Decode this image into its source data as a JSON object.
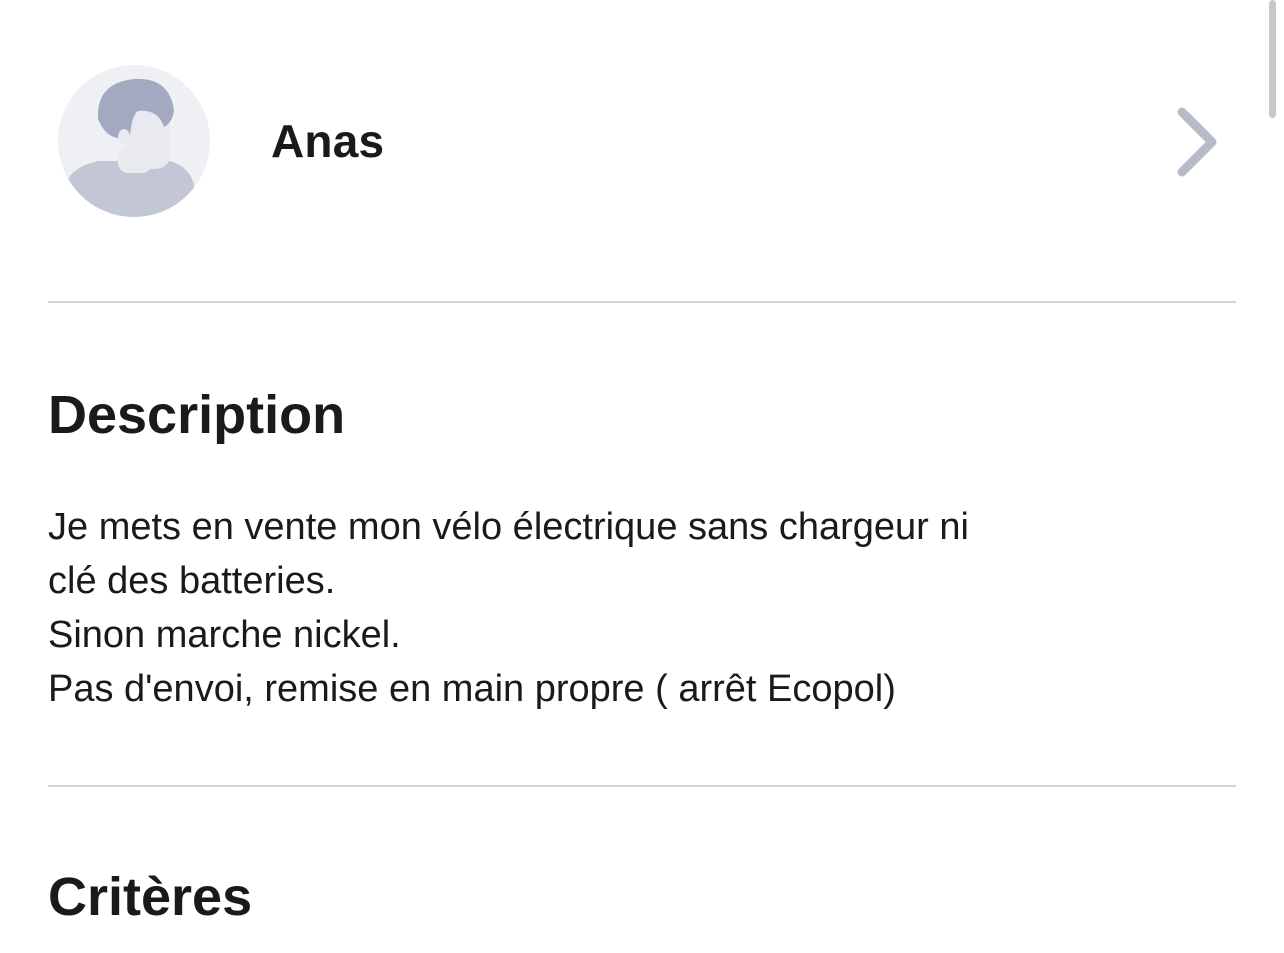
{
  "seller": {
    "name": "Anas",
    "avatar_icon": "default-person-avatar-icon",
    "chevron_icon": "chevron-right-icon"
  },
  "description": {
    "title": "Description",
    "lines": [
      "Je mets en vente mon vélo électrique sans chargeur ni",
      "clé des batteries.",
      "Sinon marche nickel.",
      "Pas d'envoi, remise en main propre ( arrêt Ecopol)"
    ]
  },
  "criteria": {
    "title": "Critères"
  },
  "colors": {
    "avatar_background": "#eef0f4",
    "avatar_figure": "#a9aec4",
    "avatar_face": "#e9eaef",
    "divider": "#d6d7db",
    "chevron": "#b8bcc8",
    "text": "#1a1a1a"
  }
}
